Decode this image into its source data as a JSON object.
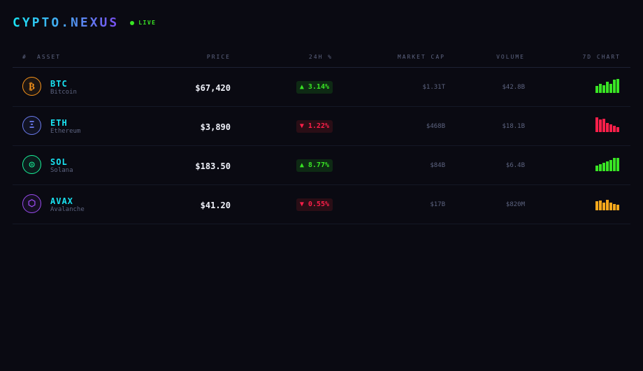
{
  "brand": {
    "prefix": "CYPTO",
    "dot": ".",
    "suffix": "NEXUS",
    "status": "LIVE"
  },
  "columns": {
    "index": "#",
    "asset": "ASSET",
    "price": "PRICE",
    "change": "24H %",
    "market_cap": "MARKET CAP",
    "volume": "VOLUME",
    "chart": "7D CHART"
  },
  "colors": {
    "up": "#39e524",
    "down": "#ff1f4a",
    "neutral": "#f5a81c",
    "accent": "#19e3f2"
  },
  "assets": [
    {
      "symbol": "BTC",
      "name": "Bitcoin",
      "icon": "bitcoin-icon",
      "glyph": "₿",
      "icon_color": "#f7931a",
      "price": "$67,420",
      "direction": "up",
      "change": "▲ 3.14%",
      "market_cap": "$1.31T",
      "volume": "$42.8B",
      "chart_color": "#39e524",
      "chart_levels": [
        0.45,
        0.6,
        0.5,
        0.75,
        0.6,
        0.85,
        0.9
      ]
    },
    {
      "symbol": "ETH",
      "name": "Ethereum",
      "icon": "ethereum-icon",
      "glyph": "Ξ",
      "icon_color": "#6b7cf0",
      "price": "$3,890",
      "direction": "down",
      "change": "▼ 1.22%",
      "market_cap": "$468B",
      "volume": "$18.1B",
      "chart_color": "#ff1f4a",
      "chart_levels": [
        0.95,
        0.8,
        0.85,
        0.6,
        0.5,
        0.4,
        0.3
      ]
    },
    {
      "symbol": "SOL",
      "name": "Solana",
      "icon": "solana-icon",
      "glyph": "◎",
      "icon_color": "#19f29a",
      "price": "$183.50",
      "direction": "up",
      "change": "▲ 8.77%",
      "market_cap": "$84B",
      "volume": "$6.4B",
      "chart_color": "#39e524",
      "chart_levels": [
        0.35,
        0.45,
        0.55,
        0.65,
        0.75,
        0.85,
        0.88
      ]
    },
    {
      "symbol": "AVAX",
      "name": "Avalanche",
      "icon": "avalanche-icon",
      "glyph": "⬡",
      "icon_color": "#9a4cf0",
      "price": "$41.20",
      "direction": "down",
      "change": "▼ 0.55%",
      "market_cap": "$17B",
      "volume": "$820M",
      "chart_color": "#f5a81c",
      "chart_levels": [
        0.6,
        0.65,
        0.5,
        0.7,
        0.5,
        0.4,
        0.35
      ]
    }
  ]
}
